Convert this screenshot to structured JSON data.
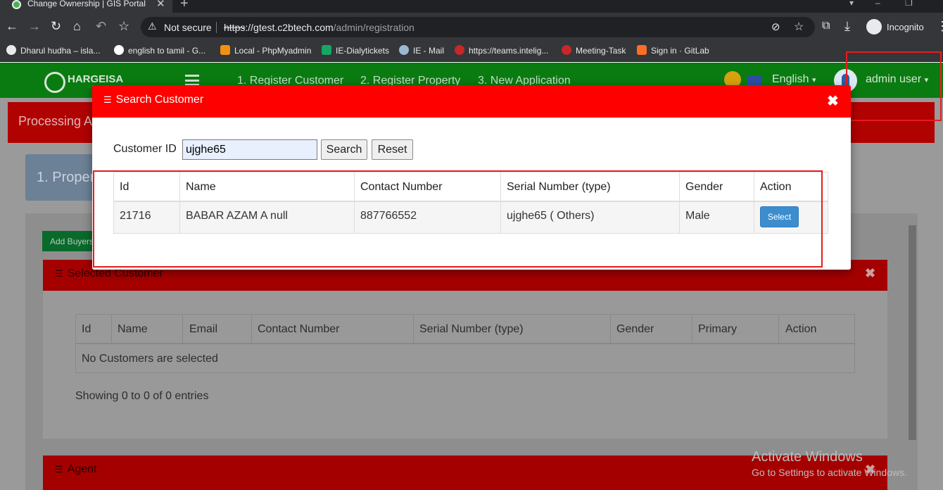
{
  "browser": {
    "tab_title": "Change Ownership | GIS Portal",
    "security_label": "Not secure",
    "url_scheme": "https",
    "url_host": "://gtest.c2btech.com",
    "url_path": "/admin/registration",
    "profile_label": "Incognito"
  },
  "bookmarks": [
    {
      "label": "Dharul hudha – isla...",
      "color": "#e8eaed"
    },
    {
      "label": "english to tamil - G...",
      "color": "#ffffff"
    },
    {
      "label": "Local - PhpMyadmin",
      "color": "#f29111"
    },
    {
      "label": "IE-Dialytickets",
      "color": "#16a765"
    },
    {
      "label": "IE - Mail",
      "color": "#9bb8d3"
    },
    {
      "label": "https://teams.intelig...",
      "color": "#c62828"
    },
    {
      "label": "Meeting-Task",
      "color": "#c62828"
    },
    {
      "label": "Sign in · GitLab",
      "color": "#fc6d26"
    }
  ],
  "site": {
    "logo_text": "HARGEISA",
    "nav": [
      "1. Register Customer",
      "2. Register Property",
      "3. New Application"
    ],
    "language": "English",
    "user": "admin user",
    "processing_title": "Processing A",
    "property_step": "1. Proper",
    "add_buyers_label": "Add Buyers"
  },
  "selected_customer": {
    "title": "Selected Customer",
    "columns": [
      "Id",
      "Name",
      "Email",
      "Contact Number",
      "Serial Number (type)",
      "Gender",
      "Primary",
      "Action"
    ],
    "empty_text": "No Customers are selected",
    "showing_text": "Showing 0 to 0 of 0 entries"
  },
  "agent": {
    "title": "Agent"
  },
  "windows_watermark": {
    "line1": "Activate Windows",
    "line2": "Go to Settings to activate Windows."
  },
  "modal": {
    "title": "Search Customer",
    "search_label": "Customer ID",
    "search_value": "ujghe65",
    "search_button": "Search",
    "reset_button": "Reset",
    "columns": [
      "Id",
      "Name",
      "Contact Number",
      "Serial Number (type)",
      "Gender",
      "Action"
    ],
    "rows": [
      {
        "id": "21716",
        "name": "BABAR AZAM A null",
        "contact": "887766552",
        "serial": "ujghe65 ( Others)",
        "gender": "Male",
        "action": "Select"
      }
    ]
  },
  "colors": {
    "navbar": "#0a7b10",
    "modal_header": "#ff0000",
    "highlight_frame": "#e51d1d",
    "select_button": "#3c8dce"
  }
}
